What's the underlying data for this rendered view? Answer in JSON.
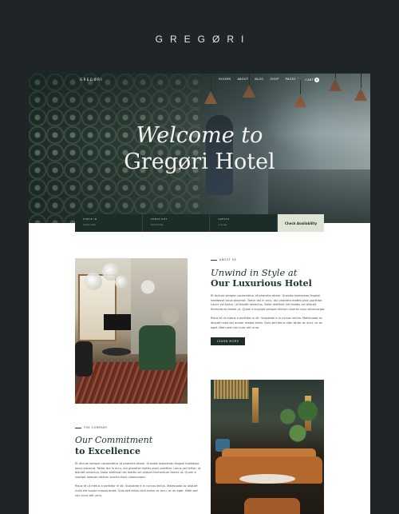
{
  "brand": "GREGØRI",
  "nav": {
    "logo": "GREGØRI",
    "links": [
      "ROOMS",
      "ABOUT",
      "BLOG",
      "SHOP",
      "PAGES ˅",
      "CART"
    ],
    "cart_count": "0"
  },
  "hero": {
    "title_line1": "Welcome to",
    "title_line2": "Gregøri Hotel"
  },
  "booking": {
    "fields": [
      {
        "label": "CHECK IN",
        "value": "Select Date"
      },
      {
        "label": "CHECK OUT",
        "value": "Select Date"
      },
      {
        "label": "GUESTS",
        "value": "1 Guest"
      }
    ],
    "button": "Check Availability"
  },
  "section_about": {
    "eyebrow": "ABOUT US",
    "title_italic": "Unwind in Style at",
    "title_bold": "Our Luxurious Hotel",
    "para1": "Et dictum semper consectetur at pharetra etiam. Gravida maecenas feugiat habitasse lacus placerat. Tortor dui in arcu, dui pharetra mattis proin porttitor. Lacus vel tortor, ut blandit senectus. Dolor eleifend nisl mattis vel aliquet fermentum fames ut. Quam a suscipit semper dictum viverra risus ullamcorper.",
    "para2": "Risus et ut metus a porttitor in sit. Vulputate a in cursus lectus. Malesuada ac aliquet nulla est auctor massa amet. Quis sed tellus nibh tortor ac arcu, ac ac eget. Nibh sed non nunc elit urna.",
    "button": "LEARN MORE"
  },
  "section_commitment": {
    "eyebrow": "THE COMPANY",
    "title_italic": "Our Commitment",
    "title_bold": "to Excellence",
    "para1": "Et dictum semper consectetur at pharetra etiam. Gravida maecenas feugiat habitasse lacus placerat. Tortor dui in arcu, dui pharetra mattis proin porttitor. Lacus vel tortor, ut blandit senectus. Dolor eleifend nisl mattis vel aliquet fermentum fames ut. Quam a suscipit semper dictum viverra risus ullamcorper.",
    "para2": "Risus et ut metus a porttitor in sit. Vulputate a in cursus lectus. Malesuada ac aliquet nulla est auctor massa amet. Quis sed tellus nibh tortor ac arcu, ac ac eget. Nibh sed non nunc elit urna."
  },
  "colors": {
    "background": "#1f2426",
    "accent_dark_green": "#1e3530",
    "button_light": "#dfe5d5"
  }
}
